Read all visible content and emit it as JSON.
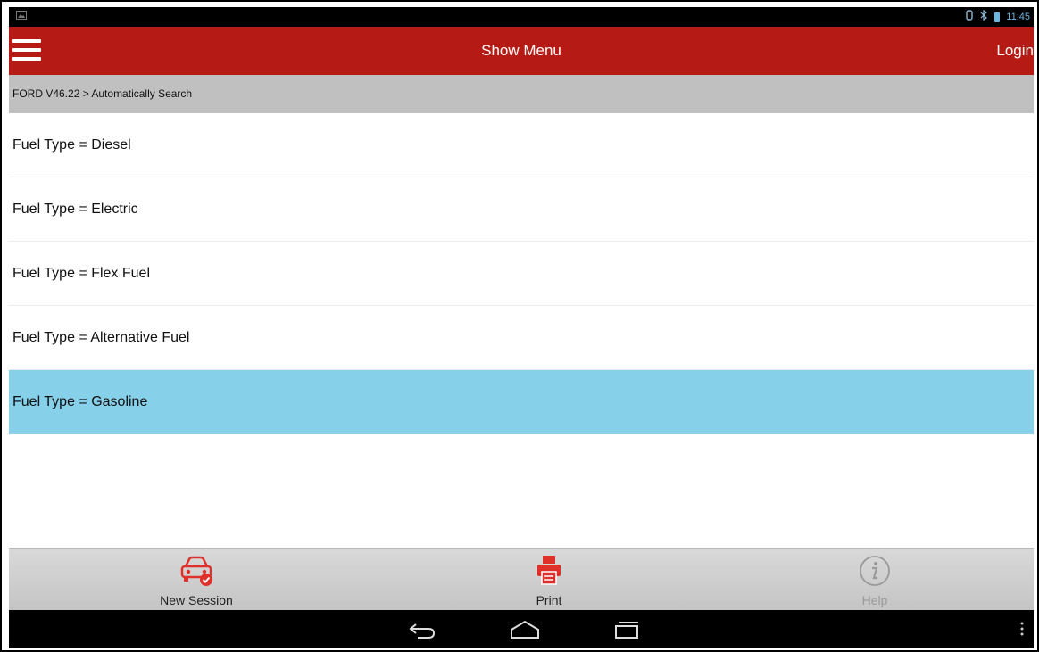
{
  "status_bar": {
    "left_icon": "photo-icon",
    "icons": [
      "settings-icon",
      "bluetooth-icon",
      "battery-icon"
    ],
    "time": "11:45"
  },
  "action_bar": {
    "menu_icon": "hamburger-menu-icon",
    "title": "Show Menu",
    "login_label": "Login",
    "color": "#b61a14"
  },
  "breadcrumb": {
    "text": "FORD V46.22 > Automatically Search"
  },
  "list": {
    "items": [
      {
        "label": "Fuel Type = Diesel",
        "selected": false
      },
      {
        "label": "Fuel Type = Electric",
        "selected": false
      },
      {
        "label": "Fuel Type = Flex Fuel",
        "selected": false
      },
      {
        "label": "Fuel Type = Alternative Fuel",
        "selected": false
      },
      {
        "label": "Fuel Type = Gasoline",
        "selected": true
      }
    ],
    "selected_color": "#86d0ea"
  },
  "toolbar": {
    "new_session_label": "New Session",
    "print_label": "Print",
    "help_label": "Help",
    "new_session_icon": "car-check-icon",
    "print_icon": "printer-icon",
    "help_icon": "info-icon",
    "accent_color": "#e0302a"
  },
  "nav_bar": {
    "icons": [
      "back-icon",
      "home-icon",
      "recent-apps-icon",
      "overflow-menu-icon"
    ]
  }
}
